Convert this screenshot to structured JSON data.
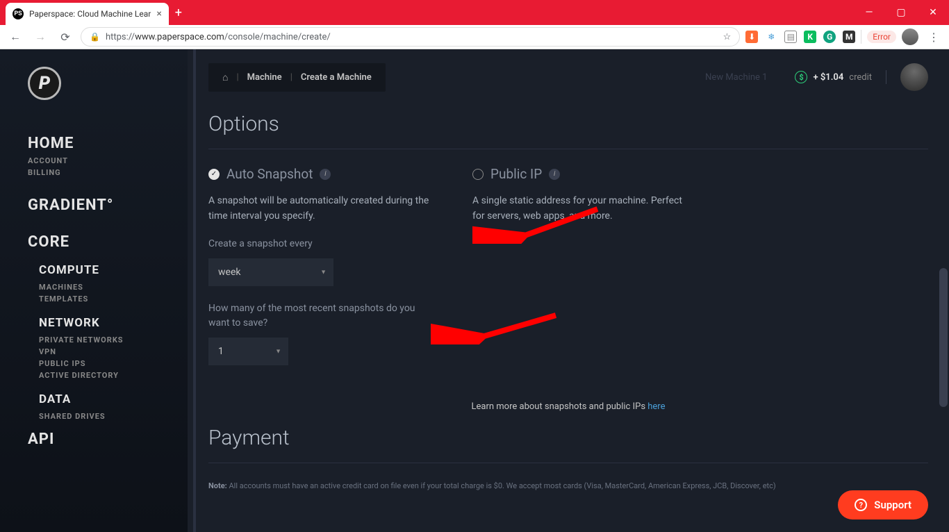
{
  "browser": {
    "tab_title": "Paperspace: Cloud Machine Lear",
    "url_proto": "https://",
    "url_host": "www.paperspace.com",
    "url_path": "/console/machine/create/",
    "error_label": "Error"
  },
  "sidebar": {
    "home": "HOME",
    "account": "ACCOUNT",
    "billing": "BILLING",
    "gradient": "GRADIENT°",
    "core": "CORE",
    "compute": "COMPUTE",
    "machines": "MACHINES",
    "templates": "TEMPLATES",
    "network": "NETWORK",
    "private_networks": "PRIVATE NETWORKS",
    "vpn": "VPN",
    "public_ips": "PUBLIC IPS",
    "active_directory": "ACTIVE DIRECTORY",
    "data": "DATA",
    "shared_drives": "SHARED DRIVES",
    "api": "API"
  },
  "breadcrumb": {
    "machine": "Machine",
    "create": "Create a Machine"
  },
  "topbar": {
    "hidden": "New Machine 1",
    "credit_prefix": "+ ",
    "credit_amount": "$1.04",
    "credit_label": "credit"
  },
  "options": {
    "title": "Options",
    "auto_snapshot": {
      "title": "Auto Snapshot",
      "desc": "A snapshot will be automatically created during the time interval you specify.",
      "freq_label": "Create a snapshot every",
      "freq_value": "week",
      "count_label": "How many of the most recent snapshots do you want to save?",
      "count_value": "1"
    },
    "public_ip": {
      "title": "Public IP",
      "desc": "A single static address for your machine. Perfect for servers, web apps, and more."
    },
    "learn_more_text": "Learn more about snapshots and public IPs ",
    "learn_more_link": "here"
  },
  "payment": {
    "title": "Payment",
    "note_label": "Note:",
    "note_text": " All accounts must have an active credit card on file even if your total charge is $0. We accept most cards (Visa, MasterCard, American Express, JCB, Discover, etc)"
  },
  "support": {
    "label": "Support"
  }
}
